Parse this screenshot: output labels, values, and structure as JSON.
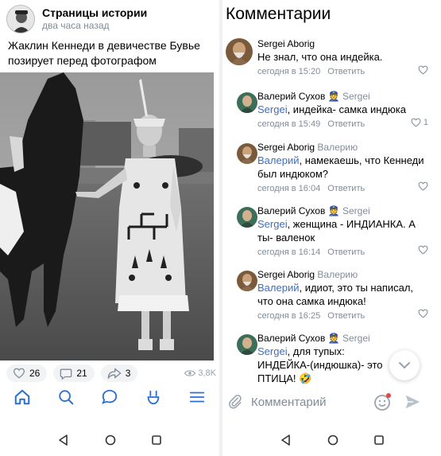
{
  "post": {
    "group_name": "Страницы истории",
    "time": "два часа назад",
    "text": "Жаклин Кеннеди в девичестве Бувье позирует перед фотографом",
    "likes": "26",
    "comments": "21",
    "shares": "3",
    "views": "3,8K"
  },
  "comments_panel": {
    "title": "Комментарии",
    "input_placeholder": "Комментарий",
    "accent_color": "#3d6ec2",
    "comments": [
      {
        "author": "Sergei Aborig",
        "reply_to": "",
        "mention": "",
        "text": "Не знал, что она индейка.",
        "time": "сегодня в 15:20",
        "reply_label": "Ответить",
        "likes": ""
      },
      {
        "author": "Валерий Сухов",
        "reply_to": "Sergei",
        "mention": "Sergei",
        "text": ", индейка- самка индюка",
        "time": "сегодня в 15:49",
        "reply_label": "Ответить",
        "likes": "1"
      },
      {
        "author": "Sergei Aborig",
        "reply_to": "Валерию",
        "mention": "Валерий",
        "text": ", намекаешь, что Кеннеди был индюком?",
        "time": "сегодня в 16:04",
        "reply_label": "Ответить",
        "likes": ""
      },
      {
        "author": "Валерий Сухов",
        "reply_to": "Sergei",
        "mention": "Sergei",
        "text": ", женщина - ИНДИАНКА. А ты- валенок",
        "time": "сегодня в 16:14",
        "reply_label": "Ответить",
        "likes": ""
      },
      {
        "author": "Sergei Aborig",
        "reply_to": "Валерию",
        "mention": "Валерий",
        "text": ", идиот, это ты написал, что она самка индюка!",
        "time": "сегодня в 16:25",
        "reply_label": "Ответить",
        "likes": ""
      },
      {
        "author": "Валерий Сухов",
        "reply_to": "Sergei",
        "mention": "Sergei",
        "text": ", для тупых: ИНДЕЙКА-(индюшка)- это ПТИЦА!",
        "emoji": "🤣",
        "time": "",
        "reply_label": "",
        "likes": ""
      }
    ]
  },
  "icons": {
    "tabbar": [
      "home-icon",
      "search-icon",
      "messages-icon",
      "clips-icon",
      "menu-icon"
    ],
    "system_nav": [
      "back-icon",
      "home-circle-icon",
      "recents-icon"
    ]
  }
}
